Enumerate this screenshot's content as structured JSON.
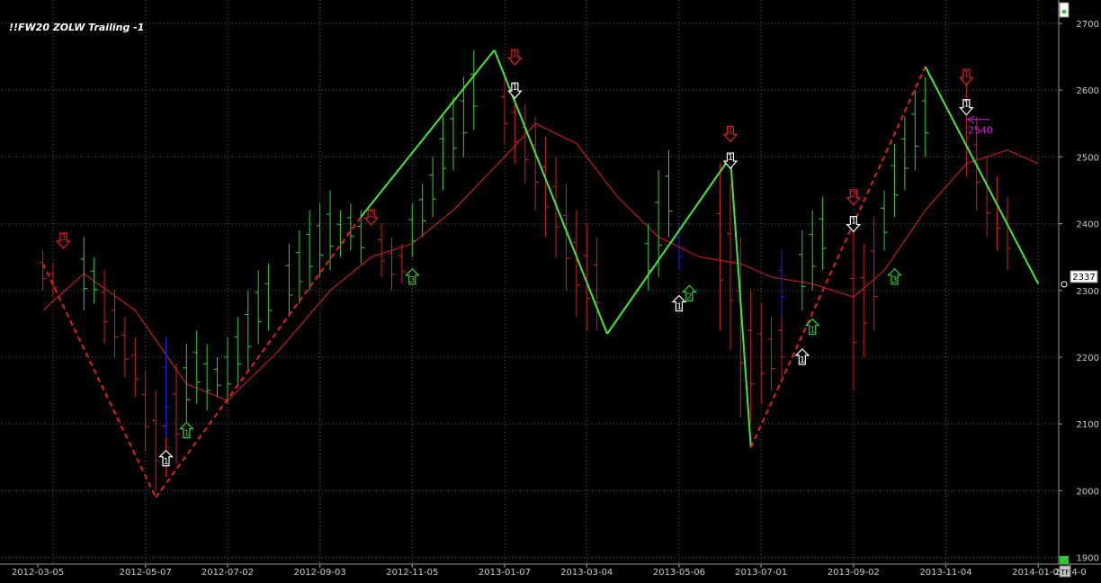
{
  "chart_data": {
    "type": "bar",
    "title": "!!FW20 ZOLW Trailing -1",
    "x_ticks": [
      "2012-03-05",
      "2012-05-07",
      "2012-07-02",
      "2012-09-03",
      "2012-11-05",
      "2013-01-07",
      "2013-03-04",
      "2013-05-06",
      "2013-07-01",
      "2013-09-02",
      "2013-11-04",
      "2014-01-06",
      "2014-0"
    ],
    "y_ticks": [
      1900,
      2000,
      2100,
      2200,
      2300,
      2400,
      2500,
      2600,
      2700
    ],
    "ylim": [
      1890,
      2735
    ],
    "last_price": 2337,
    "corner_label": "TF",
    "grid": true,
    "annotation": {
      "text": "2540",
      "value": 2540,
      "color": "#d020d0"
    },
    "colors": {
      "up": "#30d030",
      "down": "#d02020",
      "neutral": "#2020e0",
      "zigzag_solid": "#44e83a",
      "zigzag_dashed": "#e02020",
      "moving_average": "#e02020"
    },
    "zigzag": [
      {
        "date": "2012-02-27",
        "value": 2340
      },
      {
        "date": "2012-05-14",
        "value": 1990
      },
      {
        "date": "2012-10-01",
        "value": 2410
      },
      {
        "date": "2012-12-31",
        "value": 2660
      },
      {
        "date": "2013-03-18",
        "value": 2235
      },
      {
        "date": "2013-06-10",
        "value": 2500
      },
      {
        "date": "2013-06-24",
        "value": 2065
      },
      {
        "date": "2013-10-21",
        "value": 2635
      },
      {
        "date": "2014-01-06",
        "value": 2310
      }
    ],
    "zigzag_segment_styles": [
      "dashed",
      "dashed",
      "solid",
      "solid",
      "solid",
      "solid",
      "dashed",
      "solid"
    ],
    "moving_average": [
      {
        "date": "2012-02-27",
        "value": 2270
      },
      {
        "date": "2012-03-26",
        "value": 2325
      },
      {
        "date": "2012-04-30",
        "value": 2270
      },
      {
        "date": "2012-06-04",
        "value": 2160
      },
      {
        "date": "2012-07-02",
        "value": 2135
      },
      {
        "date": "2012-08-06",
        "value": 2210
      },
      {
        "date": "2012-09-10",
        "value": 2300
      },
      {
        "date": "2012-10-08",
        "value": 2350
      },
      {
        "date": "2012-11-05",
        "value": 2370
      },
      {
        "date": "2012-12-03",
        "value": 2420
      },
      {
        "date": "2013-01-07",
        "value": 2500
      },
      {
        "date": "2013-01-28",
        "value": 2550
      },
      {
        "date": "2013-02-25",
        "value": 2520
      },
      {
        "date": "2013-03-25",
        "value": 2440
      },
      {
        "date": "2013-04-22",
        "value": 2380
      },
      {
        "date": "2013-05-20",
        "value": 2350
      },
      {
        "date": "2013-06-17",
        "value": 2340
      },
      {
        "date": "2013-07-08",
        "value": 2320
      },
      {
        "date": "2013-08-05",
        "value": 2310
      },
      {
        "date": "2013-09-02",
        "value": 2290
      },
      {
        "date": "2013-09-23",
        "value": 2330
      },
      {
        "date": "2013-10-21",
        "value": 2420
      },
      {
        "date": "2013-11-18",
        "value": 2490
      },
      {
        "date": "2013-12-16",
        "value": 2510
      },
      {
        "date": "2014-01-06",
        "value": 2490
      }
    ],
    "bar_segments": [
      {
        "date": "2012-02-27",
        "bars": [
          [
            2300,
            2360
          ],
          [
            2290,
            2340
          ]
        ],
        "color": "down"
      },
      {
        "date": "2012-03-26",
        "bars": [
          [
            2270,
            2380
          ],
          [
            2280,
            2350
          ]
        ],
        "color": "up"
      },
      {
        "date": "2012-04-09",
        "bars": [
          [
            2220,
            2330
          ],
          [
            2200,
            2300
          ],
          [
            2170,
            2260
          ],
          [
            2140,
            2230
          ]
        ],
        "color": "down"
      },
      {
        "date": "2012-05-07",
        "bars": [
          [
            2060,
            2180
          ],
          [
            2000,
            2150
          ],
          [
            2020,
            2130
          ],
          [
            2040,
            2190
          ]
        ],
        "color": "down"
      },
      {
        "date": "2012-05-21",
        "bars": [
          [
            2080,
            2230
          ]
        ],
        "color": "neutral"
      },
      {
        "date": "2012-06-04",
        "bars": [
          [
            2100,
            2220
          ],
          [
            2130,
            2240
          ],
          [
            2120,
            2220
          ],
          [
            2140,
            2200
          ]
        ],
        "color": "up"
      },
      {
        "date": "2012-07-02",
        "bars": [
          [
            2130,
            2230
          ],
          [
            2160,
            2260
          ],
          [
            2180,
            2300
          ],
          [
            2220,
            2330
          ],
          [
            2240,
            2340
          ]
        ],
        "color": "up"
      },
      {
        "date": "2012-08-13",
        "bars": [
          [
            2260,
            2370
          ],
          [
            2280,
            2390
          ],
          [
            2300,
            2420
          ],
          [
            2320,
            2430
          ],
          [
            2330,
            2450
          ]
        ],
        "color": "up"
      },
      {
        "date": "2012-09-17",
        "bars": [
          [
            2350,
            2420
          ],
          [
            2360,
            2430
          ],
          [
            2340,
            2420
          ]
        ],
        "color": "up"
      },
      {
        "date": "2012-10-15",
        "bars": [
          [
            2320,
            2400
          ],
          [
            2300,
            2380
          ],
          [
            2310,
            2370
          ]
        ],
        "color": "down"
      },
      {
        "date": "2012-11-05",
        "bars": [
          [
            2350,
            2430
          ],
          [
            2380,
            2460
          ],
          [
            2410,
            2500
          ],
          [
            2450,
            2560
          ],
          [
            2480,
            2590
          ],
          [
            2500,
            2620
          ],
          [
            2540,
            2660
          ]
        ],
        "color": "up"
      },
      {
        "date": "2013-01-07",
        "bars": [
          [
            2520,
            2620
          ],
          [
            2490,
            2600
          ],
          [
            2460,
            2580
          ],
          [
            2420,
            2560
          ],
          [
            2380,
            2530
          ],
          [
            2350,
            2500
          ],
          [
            2300,
            2460
          ],
          [
            2260,
            2420
          ],
          [
            2240,
            2400
          ],
          [
            2240,
            2380
          ]
        ],
        "color": "down"
      },
      {
        "date": "2013-04-15",
        "bars": [
          [
            2300,
            2400
          ],
          [
            2320,
            2480
          ],
          [
            2380,
            2510
          ]
        ],
        "color": "up"
      },
      {
        "date": "2013-05-06",
        "bars": [
          [
            2330,
            2400
          ]
        ],
        "color": "neutral"
      },
      {
        "date": "2013-06-03",
        "bars": [
          [
            2240,
            2490
          ],
          [
            2210,
            2460
          ]
        ],
        "color": "down"
      },
      {
        "date": "2013-06-17",
        "bars": [
          [
            2110,
            2380
          ],
          [
            2100,
            2300
          ],
          [
            2130,
            2280
          ],
          [
            2150,
            2260
          ],
          [
            2170,
            2270
          ]
        ],
        "color": "down"
      },
      {
        "date": "2013-07-15",
        "bars": [
          [
            2260,
            2360
          ]
        ],
        "color": "neutral"
      },
      {
        "date": "2013-07-29",
        "bars": [
          [
            2270,
            2390
          ],
          [
            2300,
            2420
          ],
          [
            2330,
            2440
          ]
        ],
        "color": "up"
      },
      {
        "date": "2013-09-02",
        "bars": [
          [
            2150,
            2390
          ],
          [
            2200,
            2370
          ],
          [
            2240,
            2410
          ]
        ],
        "color": "down"
      },
      {
        "date": "2013-09-23",
        "bars": [
          [
            2360,
            2450
          ],
          [
            2410,
            2520
          ],
          [
            2450,
            2560
          ],
          [
            2480,
            2600
          ],
          [
            2500,
            2620
          ]
        ],
        "color": "up"
      },
      {
        "date": "2013-11-18",
        "bars": [
          [
            2470,
            2620
          ],
          [
            2420,
            2560
          ],
          [
            2380,
            2500
          ],
          [
            2360,
            2470
          ],
          [
            2330,
            2440
          ]
        ],
        "color": "down"
      }
    ],
    "markers": [
      {
        "date": "2012-03-12",
        "value": 2375,
        "label": "3",
        "color": "red",
        "dir": "down"
      },
      {
        "date": "2012-05-21",
        "value": 2048,
        "label": "1",
        "color": "white",
        "dir": "up"
      },
      {
        "date": "2012-06-04",
        "value": 2090,
        "label": "1",
        "color": "green",
        "dir": "up"
      },
      {
        "date": "2012-10-08",
        "value": 2410,
        "label": "2",
        "color": "red",
        "dir": "down"
      },
      {
        "date": "2012-11-05",
        "value": 2320,
        "label": "3",
        "color": "green",
        "dir": "up"
      },
      {
        "date": "2013-01-14",
        "value": 2650,
        "label": "1",
        "color": "red",
        "dir": "down"
      },
      {
        "date": "2013-01-14",
        "value": 2600,
        "label": "1",
        "color": "white",
        "dir": "down"
      },
      {
        "date": "2013-05-06",
        "value": 2280,
        "label": "1",
        "color": "white",
        "dir": "up"
      },
      {
        "date": "2013-05-13",
        "value": 2295,
        "label": "2",
        "color": "green",
        "dir": "up"
      },
      {
        "date": "2013-06-10",
        "value": 2535,
        "label": "1",
        "color": "red",
        "dir": "down"
      },
      {
        "date": "2013-06-10",
        "value": 2495,
        "label": "1",
        "color": "white",
        "dir": "down"
      },
      {
        "date": "2013-07-29",
        "value": 2200,
        "label": "1",
        "color": "white",
        "dir": "up"
      },
      {
        "date": "2013-08-05",
        "value": 2245,
        "label": "1",
        "color": "green",
        "dir": "up"
      },
      {
        "date": "2013-09-02",
        "value": 2440,
        "label": "2",
        "color": "red",
        "dir": "down"
      },
      {
        "date": "2013-09-02",
        "value": 2400,
        "label": "1",
        "color": "white",
        "dir": "down"
      },
      {
        "date": "2013-09-30",
        "value": 2320,
        "label": "3",
        "color": "green",
        "dir": "up"
      },
      {
        "date": "2013-11-18",
        "value": 2620,
        "label": "1",
        "color": "red",
        "dir": "down"
      },
      {
        "date": "2013-11-18",
        "value": 2575,
        "label": "1",
        "color": "white",
        "dir": "down"
      }
    ]
  }
}
